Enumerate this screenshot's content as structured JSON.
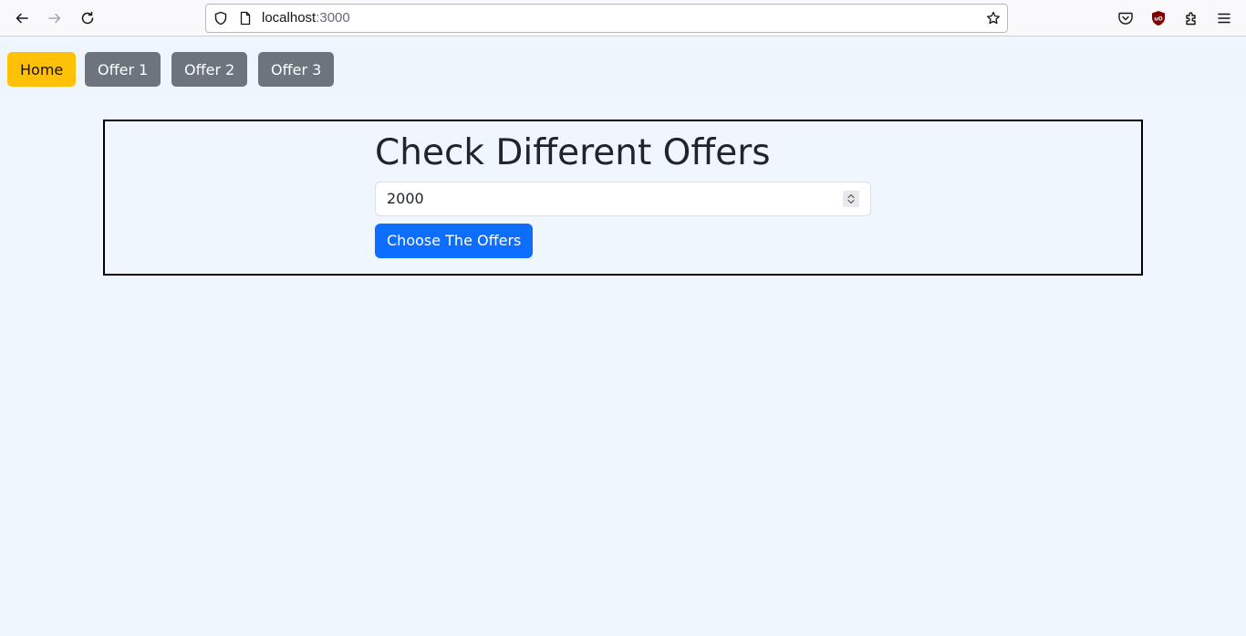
{
  "browser": {
    "url_host": "localhost",
    "url_port": ":3000",
    "icons": {
      "back": "back-arrow-icon",
      "forward": "forward-arrow-icon",
      "reload": "reload-icon",
      "shield": "tracking-shield-icon",
      "page": "page-info-icon",
      "bookmark": "bookmark-star-icon",
      "pocket": "pocket-icon",
      "ublock": "ublock-origin-icon",
      "extensions": "extensions-puzzle-icon",
      "menu": "hamburger-menu-icon"
    }
  },
  "nav": {
    "buttons": [
      {
        "label": "Home",
        "variant": "warning"
      },
      {
        "label": "Offer 1",
        "variant": "secondary"
      },
      {
        "label": "Offer 2",
        "variant": "secondary"
      },
      {
        "label": "Offer 3",
        "variant": "secondary"
      }
    ]
  },
  "main": {
    "heading": "Check Different Offers",
    "amount_value": "2000",
    "submit_label": "Choose The Offers"
  },
  "colors": {
    "page_background": "#f0f6fe",
    "warning": "#ffc107",
    "secondary": "#6c757d",
    "primary": "#0d6efd",
    "card_border": "#000000"
  }
}
